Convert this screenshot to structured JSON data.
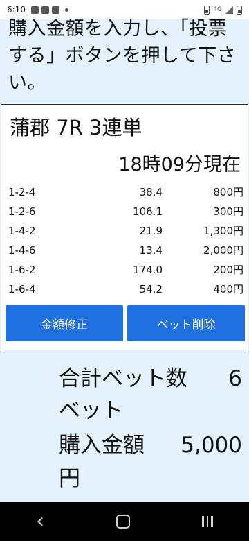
{
  "statusbar": {
    "time": "6:10",
    "network": "4G"
  },
  "instruction": "購入金額を入力し、「投票する」ボタンを押して下さい。",
  "card": {
    "title": "蒲郡 7R 3連単",
    "time": "18時09分現在",
    "rows": [
      {
        "combo": "1-2-4",
        "odds": "38.4",
        "amount": "800円"
      },
      {
        "combo": "1-2-6",
        "odds": "106.1",
        "amount": "300円"
      },
      {
        "combo": "1-4-2",
        "odds": "21.9",
        "amount": "1,300円"
      },
      {
        "combo": "1-4-6",
        "odds": "13.4",
        "amount": "2,000円"
      },
      {
        "combo": "1-6-2",
        "odds": "174.0",
        "amount": "200円"
      },
      {
        "combo": "1-6-4",
        "odds": "54.2",
        "amount": "400円"
      }
    ],
    "edit_label": "金額修正",
    "delete_label": "ベット削除"
  },
  "summary": {
    "count_label": "合計ベット数",
    "count_value": "6",
    "count_unit": "ベット",
    "amount_label": "購入金額",
    "amount_value": "5,000",
    "amount_unit": "円"
  },
  "colors": {
    "button": "#1e6fe0",
    "background": "#e3f1fc"
  }
}
